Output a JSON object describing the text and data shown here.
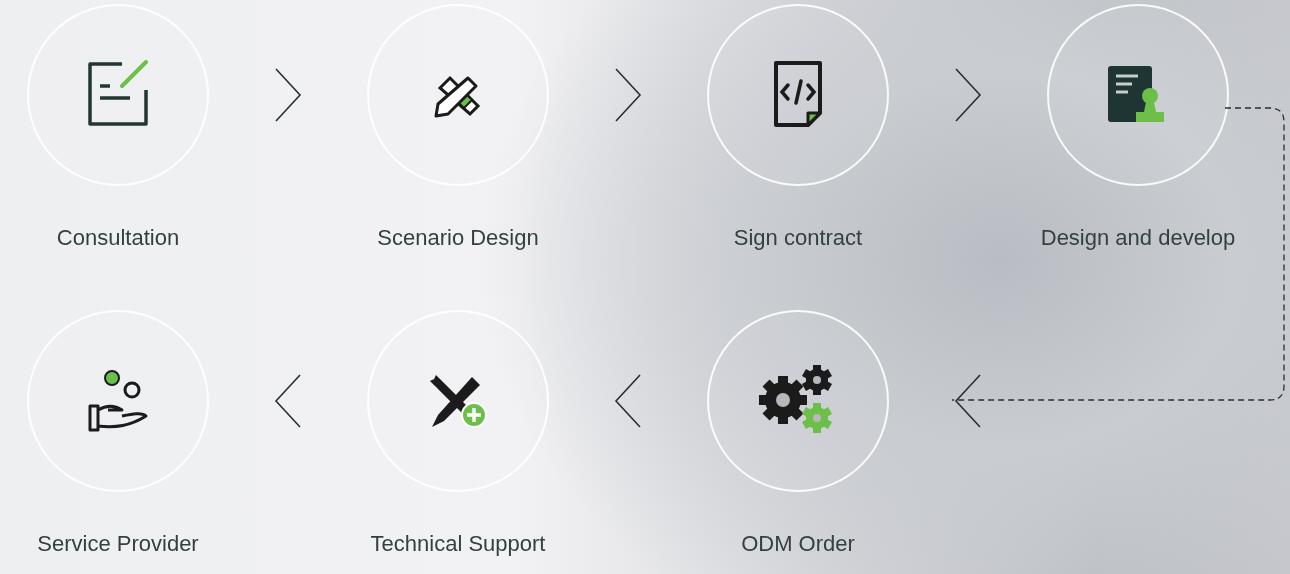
{
  "rows": [
    {
      "steps": [
        {
          "label": "Consultation"
        },
        {
          "label": "Scenario Design"
        },
        {
          "label": "Sign contract"
        },
        {
          "label": "Design and develop"
        }
      ]
    },
    {
      "steps": [
        {
          "label": "Service Provider"
        },
        {
          "label": "Technical Support"
        },
        {
          "label": "ODM Order"
        }
      ]
    }
  ]
}
